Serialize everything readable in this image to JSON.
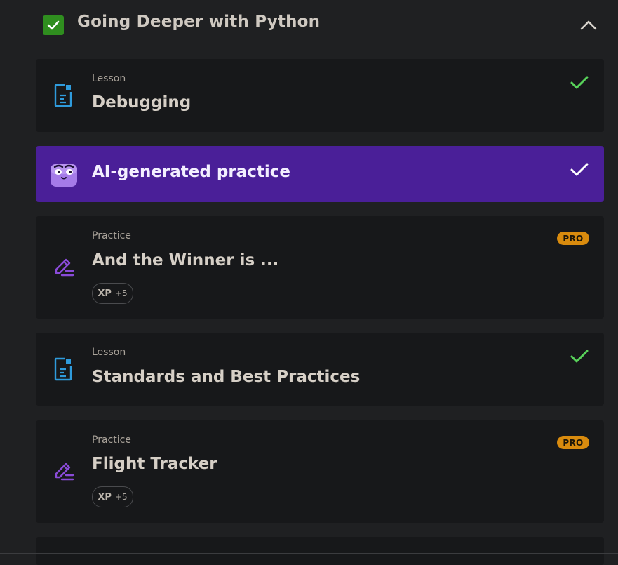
{
  "section": {
    "title": "Going Deeper with Python",
    "completed": true
  },
  "items": [
    {
      "type_label": "Lesson",
      "title": "Debugging",
      "icon": "lesson-document-icon",
      "completed": true
    },
    {
      "title": "AI-generated practice",
      "icon": "ai-mascot-icon",
      "completed": true
    },
    {
      "type_label": "Practice",
      "title": "And the Winner is ...",
      "icon": "practice-pencil-icon",
      "pro": "PRO",
      "xp_key": "XP",
      "xp_value": "+5"
    },
    {
      "type_label": "Lesson",
      "title": "Standards and Best Practices",
      "icon": "lesson-document-icon",
      "completed": true
    },
    {
      "type_label": "Practice",
      "title": "Flight Tracker",
      "icon": "practice-pencil-icon",
      "pro": "PRO",
      "xp_key": "XP",
      "xp_value": "+5"
    }
  ],
  "colors": {
    "background": "#1f2022",
    "card": "#17181a",
    "ai_card": "#4a1f98",
    "check_green": "#58d25a",
    "pro_orange": "#d98b0e",
    "lesson_icon_blue": "#2f9bdc",
    "practice_icon_purple": "#8a4bd8"
  }
}
